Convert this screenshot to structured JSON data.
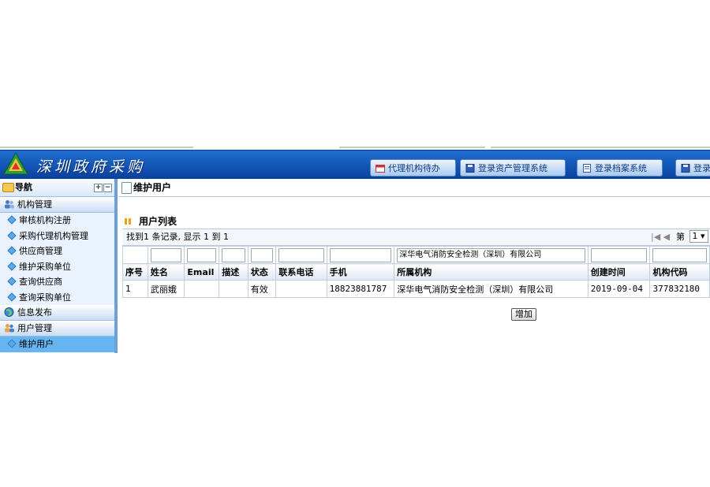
{
  "header": {
    "title": "深圳政府采购",
    "buttons": [
      {
        "label": "代理机构待办",
        "icon": "calendar-icon"
      },
      {
        "label": "登录资产管理系统",
        "icon": "disk-icon"
      },
      {
        "label": "登录档案系统",
        "icon": "document-icon"
      },
      {
        "label": "登录",
        "icon": "disk-icon"
      }
    ]
  },
  "sidebar": {
    "nav_label": "导航",
    "sections": [
      {
        "label": "机构管理",
        "items": [
          "审核机构注册",
          "采购代理机构管理",
          "供应商管理",
          "维护采购单位",
          "查询供应商",
          "查询采购单位"
        ]
      },
      {
        "label": "信息发布"
      },
      {
        "label": "用户管理",
        "items": [
          "维护用户"
        ],
        "active_item": "维护用户"
      }
    ]
  },
  "content": {
    "breadcrumb": "维护用户",
    "list_title": "用户列表",
    "pager": {
      "summary": "找到1 条记录, 显示 1 到 1",
      "page_label": "第",
      "page_value": "1"
    },
    "filters": [
      "",
      "",
      "",
      "",
      "",
      "",
      "",
      "深华电气消防安全检测（深圳）有限公司",
      "",
      ""
    ],
    "columns": [
      "序号",
      "姓名",
      "Email",
      "描述",
      "状态",
      "联系电话",
      "手机",
      "所属机构",
      "创建时间",
      "机构代码"
    ],
    "rows": [
      [
        "1",
        "武丽娥",
        "",
        "",
        "有效",
        "",
        "18823881787",
        "深华电气消防安全检测（深圳）有限公司",
        "2019-09-04",
        "377832180"
      ]
    ],
    "add_button": "增加"
  },
  "colors": {
    "header_blue": "#0a3f9e",
    "sidebar_active": "#66b4f0",
    "sidebar_bg": "#eaf2fd"
  }
}
